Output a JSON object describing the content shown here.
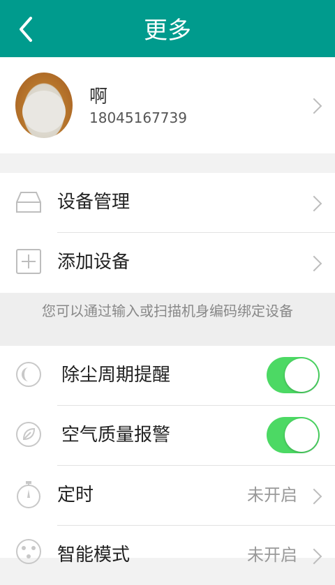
{
  "header": {
    "title": "更多"
  },
  "profile": {
    "name": "啊",
    "phone": "18045167739"
  },
  "devices": [
    {
      "label": "设备管理"
    },
    {
      "label": "添加设备"
    }
  ],
  "hint": "您可以通过输入或扫描机身编码绑定设备",
  "settings": [
    {
      "label": "除尘周期提醒",
      "toggle": "on"
    },
    {
      "label": "空气质量报警",
      "toggle": "on"
    },
    {
      "label": "定时",
      "value": "未开启"
    },
    {
      "label": "智能模式",
      "value": "未开启"
    }
  ],
  "colors": {
    "accent": "#009b8d",
    "toggle_on": "#4cd964"
  }
}
